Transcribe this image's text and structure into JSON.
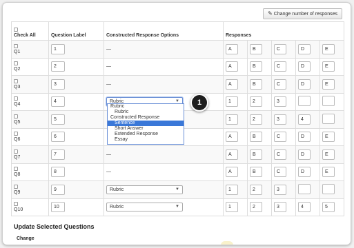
{
  "toolbar": {
    "change_responses_label": "Change number of responses"
  },
  "table": {
    "headers": {
      "check_all": "Check All",
      "question_label": "Question Label",
      "constructed_response": "Constructed Response Options",
      "responses": "Responses"
    },
    "rows": [
      {
        "q": "Q1",
        "label": "1",
        "cr": "—",
        "responses": [
          "A",
          "B",
          "C",
          "D",
          "E"
        ]
      },
      {
        "q": "Q2",
        "label": "2",
        "cr": "—",
        "responses": [
          "A",
          "B",
          "C",
          "D",
          "E"
        ]
      },
      {
        "q": "Q3",
        "label": "3",
        "cr": "—",
        "responses": [
          "A",
          "B",
          "C",
          "D",
          "E"
        ]
      },
      {
        "q": "Q4",
        "label": "4",
        "cr": "Rubric",
        "responses": [
          "1",
          "2",
          "3",
          "",
          ""
        ]
      },
      {
        "q": "Q5",
        "label": "5",
        "cr": "",
        "responses": [
          "1",
          "2",
          "3",
          "4",
          ""
        ]
      },
      {
        "q": "Q6",
        "label": "6",
        "cr": "",
        "responses": [
          "A",
          "B",
          "C",
          "D",
          "E"
        ]
      },
      {
        "q": "Q7",
        "label": "7",
        "cr": "—",
        "responses": [
          "A",
          "B",
          "C",
          "D",
          "E"
        ]
      },
      {
        "q": "Q8",
        "label": "8",
        "cr": "—",
        "responses": [
          "A",
          "B",
          "C",
          "D",
          "E"
        ]
      },
      {
        "q": "Q9",
        "label": "9",
        "cr": "Rubric",
        "responses": [
          "1",
          "2",
          "3",
          "",
          ""
        ]
      },
      {
        "q": "Q10",
        "label": "10",
        "cr": "Rubric",
        "responses": [
          "1",
          "2",
          "3",
          "4",
          "5"
        ]
      }
    ]
  },
  "dropdown": {
    "items": [
      {
        "text": "Rubric",
        "kind": "group"
      },
      {
        "text": "Rubric",
        "kind": "option"
      },
      {
        "text": "Constructed Response",
        "kind": "group"
      },
      {
        "text": "Sentence",
        "kind": "option",
        "highlighted": true
      },
      {
        "text": "Short Answer",
        "kind": "option"
      },
      {
        "text": "Extended Response",
        "kind": "option"
      },
      {
        "text": "Essay",
        "kind": "option"
      }
    ]
  },
  "callout": {
    "number": "1"
  },
  "update_section": {
    "title": "Update Selected Questions",
    "sub": "Change"
  }
}
